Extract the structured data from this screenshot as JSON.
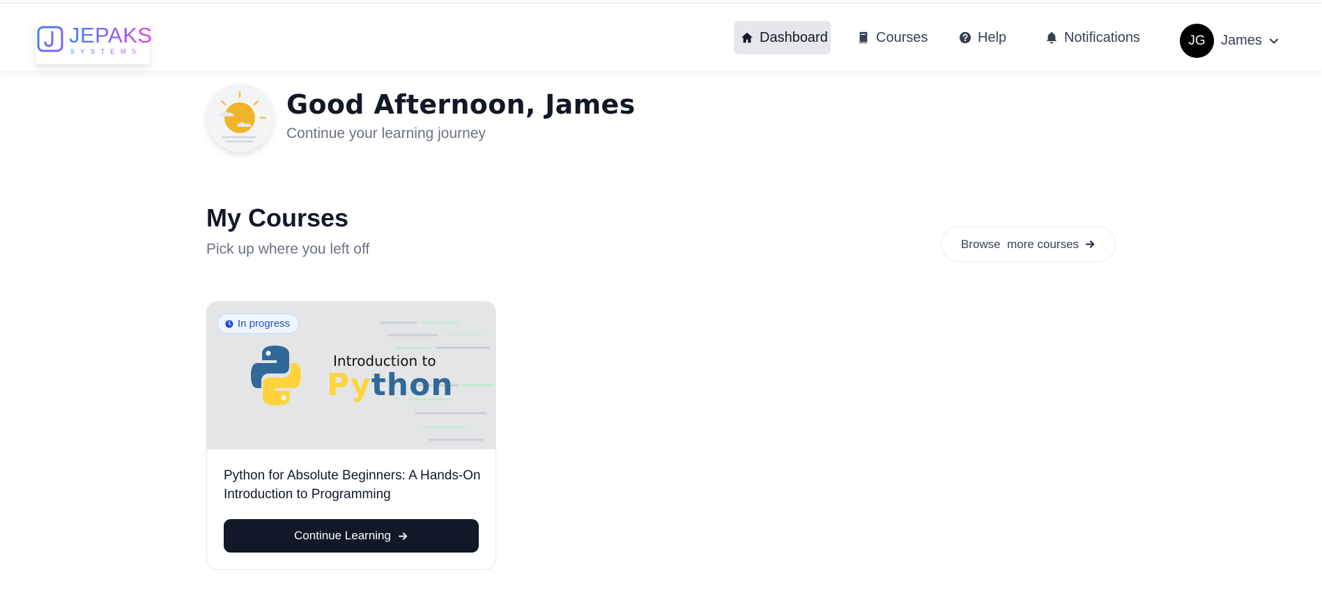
{
  "header": {
    "logo": {
      "word": "JEPAKS",
      "sub": "SYSTEMS",
      "mark": "J"
    },
    "nav": [
      {
        "label": "Dashboard",
        "icon": "home-icon"
      },
      {
        "label": "Courses",
        "icon": "book-icon"
      },
      {
        "label": "Help",
        "icon": "question-circle-icon"
      },
      {
        "label": "Notifications",
        "icon": "bell-icon"
      }
    ],
    "user": {
      "initials": "JG",
      "name": "James",
      "icon": "chevron-down-icon"
    }
  },
  "greeting": {
    "title": "Good Afternoon, James",
    "subtitle": "Continue your learning journey",
    "icon": "sun-cloud-icon"
  },
  "courses_section": {
    "title": "My Courses",
    "subtitle": "Pick up where you left off",
    "browse_label": "Browse  more courses"
  },
  "courses": [
    {
      "status": "In progress",
      "thumb_intro": "Introduction to",
      "thumb_word_a": "Py",
      "thumb_word_b": "thon",
      "title": "Python for Absolute Beginners: A Hands-On Introduction to Programming",
      "cta": "Continue Learning"
    }
  ],
  "colors": {
    "primary_dark": "#111827",
    "nav_active_bg": "#e5e7eb",
    "badge_blue": "#1d4ed8",
    "python_yellow": "#ffd43b",
    "python_blue": "#306998"
  }
}
